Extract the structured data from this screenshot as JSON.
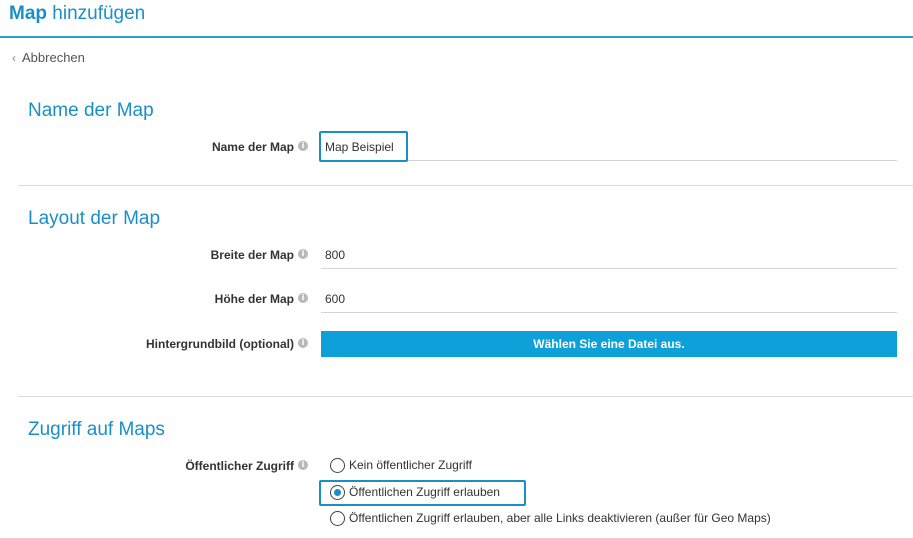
{
  "header": {
    "title_bold": "Map",
    "title_rest": "hinzufügen"
  },
  "back": {
    "label": "Abbrechen"
  },
  "sections": {
    "name": {
      "title": "Name der Map",
      "field_label": "Name der Map",
      "field_value": "Map Beispiel"
    },
    "layout": {
      "title": "Layout der Map",
      "width_label": "Breite der Map",
      "width_value": "800",
      "height_label": "Höhe der Map",
      "height_value": "600",
      "background_label": "Hintergrundbild (optional)",
      "file_button_label": "Wählen Sie eine Datei aus."
    },
    "access": {
      "title": "Zugriff auf Maps",
      "field_label": "Öffentlicher Zugriff",
      "options": [
        {
          "label": "Kein öffentlicher Zugriff",
          "checked": false
        },
        {
          "label": "Öffentlichen Zugriff erlauben",
          "checked": true
        },
        {
          "label": "Öffentlichen Zugriff erlauben, aber alle Links deaktivieren (außer für Geo Maps)",
          "checked": false
        }
      ]
    }
  },
  "info_glyph": "i",
  "colors": {
    "accent": "#1a8fc7",
    "button": "#0ea0d8",
    "divider": "#d9d9d9"
  }
}
